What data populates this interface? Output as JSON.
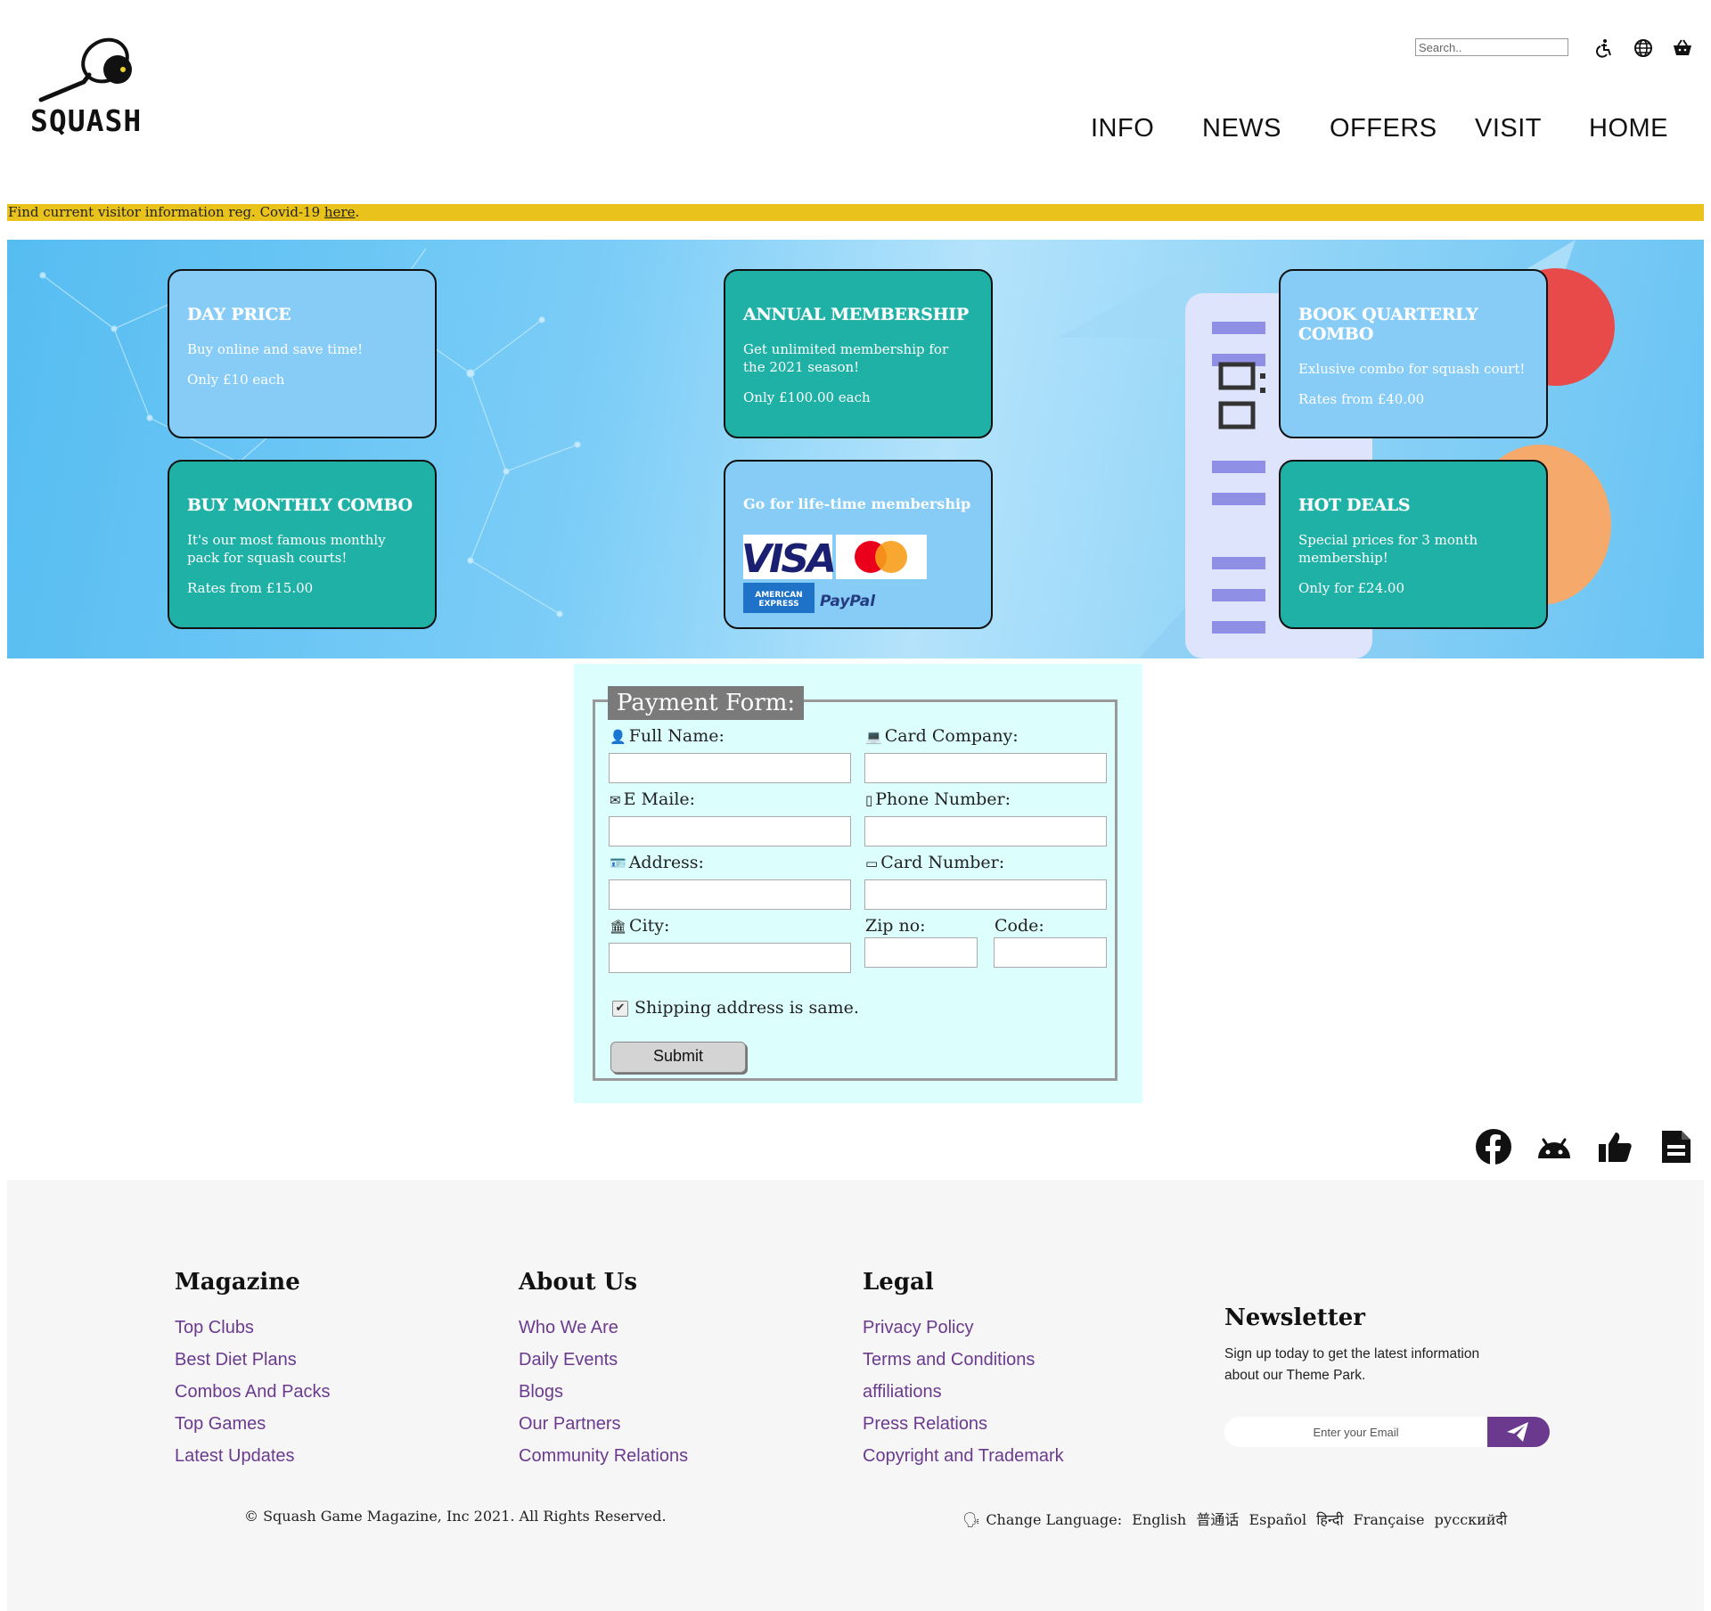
{
  "brand": {
    "name": "SQUASH"
  },
  "search": {
    "placeholder": "Search.."
  },
  "header_icons": [
    "accessibility-icon",
    "globe-icon",
    "basket-icon"
  ],
  "nav": [
    "INFO",
    "NEWS",
    "OFFERS",
    "VISIT",
    "HOME"
  ],
  "covid": {
    "text": "Find current visitor information reg. Covid-19 ",
    "link": "here",
    "end": "."
  },
  "cards": {
    "day_price": {
      "title": "DAY PRICE",
      "line1": "Buy online and save time!",
      "line2": "Only £10 each"
    },
    "annual": {
      "title": "ANNUAL MEMBERSHIP",
      "line1": "Get unlimited membership for the 2021 season!",
      "line2": "Only £100.00 each"
    },
    "quarterly": {
      "title": "BOOK QUARTERLY COMBO",
      "line1": "Exlusive combo for squash court!",
      "line2": "Rates from £40.00"
    },
    "monthly": {
      "title": "BUY MONTHLY COMBO",
      "line1": "It's our most famous monthly pack for squash courts!",
      "line2": "Rates from £15.00"
    },
    "lifetime": {
      "title": "Go for life-time membership",
      "visa": "VISA",
      "amex": "AMERICAN EXPRESS",
      "paypal": "PayPal"
    },
    "hot": {
      "title": "HOT DEALS",
      "line1": "Special prices for 3 month membership!",
      "line2": "Only for £24.00"
    }
  },
  "form": {
    "legend": "Payment Form:",
    "full_name": "Full Name:",
    "card_company": "Card Company:",
    "email": "E Maile:",
    "phone": "Phone Number:",
    "address": "Address:",
    "card_number": "Card Number:",
    "city": "City:",
    "zip": "Zip no:",
    "code": "Code:",
    "shipping": "Shipping address is same.",
    "shipping_checked": true,
    "submit": "Submit"
  },
  "social": [
    "facebook-icon",
    "android-icon",
    "thumbs-up-icon",
    "document-icon"
  ],
  "footer": {
    "magazine": {
      "title": "Magazine",
      "links": [
        "Top Clubs",
        "Best Diet Plans",
        "Combos And Packs",
        "Top Games",
        "Latest Updates"
      ]
    },
    "about": {
      "title": "About Us",
      "links": [
        "Who We Are",
        "Daily Events",
        "Blogs",
        "Our Partners",
        "Community Relations"
      ]
    },
    "legal": {
      "title": "Legal",
      "links": [
        "Privacy Policy",
        "Terms and Conditions",
        "affiliations",
        "Press Relations",
        "Copyright and Trademark"
      ]
    },
    "newsletter": {
      "title": "Newsletter",
      "text": "Sign up today to get the latest information about our Theme Park.",
      "placeholder": "Enter your Email"
    },
    "copyright": "© Squash Game Magazine, Inc 2021. All Rights Reserved.",
    "language": {
      "label": "Change Language:",
      "options": [
        "English",
        "普通话",
        "Español",
        "हिन्दी",
        "Française",
        "русскийदी"
      ]
    }
  },
  "colors": {
    "accent_yellow": "#e9c21c",
    "teal": "#1fb1a6",
    "light_blue": "#86ccf7",
    "footer_link": "#6b3a8f",
    "form_bg": "#dcfffe"
  }
}
